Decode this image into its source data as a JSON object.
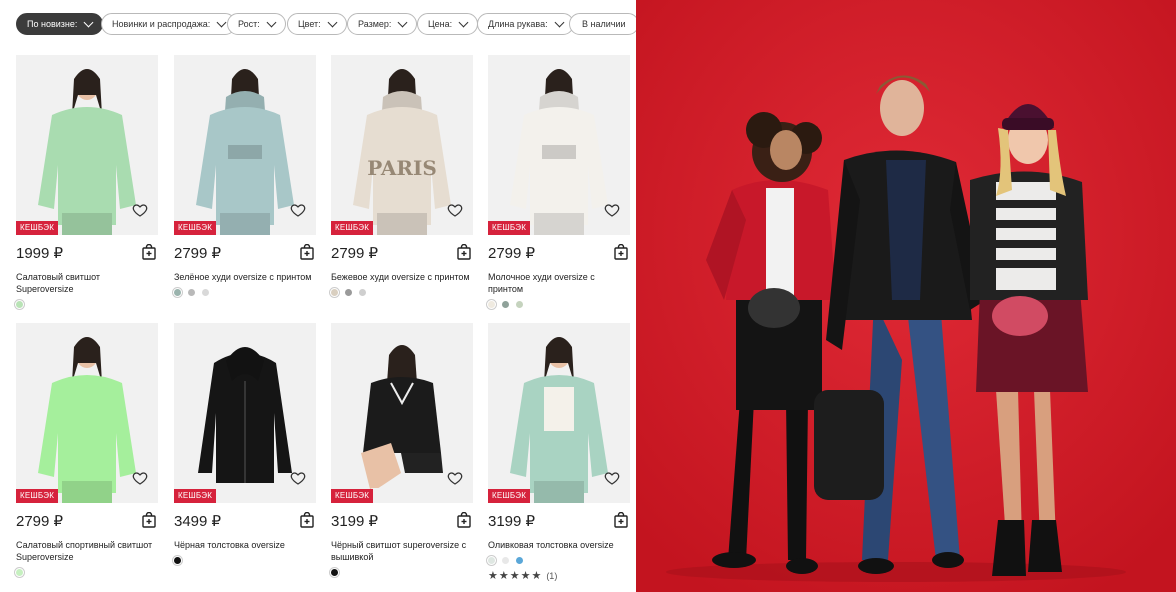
{
  "filters": [
    {
      "label": "По новизне:",
      "active": true,
      "dropdown": true
    },
    {
      "label": "Новинки и распродажа:",
      "active": false,
      "dropdown": true
    },
    {
      "label": "Рост:",
      "active": false,
      "dropdown": true
    },
    {
      "label": "Цвет:",
      "active": false,
      "dropdown": true
    },
    {
      "label": "Размер:",
      "active": false,
      "dropdown": true
    },
    {
      "label": "Цена:",
      "active": false,
      "dropdown": true
    },
    {
      "label": "Длина рукава:",
      "active": false,
      "dropdown": true
    },
    {
      "label": "В наличии",
      "active": false,
      "dropdown": false
    }
  ],
  "products": [
    {
      "badge": "КЕШБЭК",
      "price": "1999 ₽",
      "title": "Салатовый свитшот Superoversize",
      "swatches": [
        "#b9e3b6"
      ],
      "garment_color": "#a9dcb0",
      "garment_type": "sweatshirt"
    },
    {
      "badge": "КЕШБЭК",
      "price": "2799 ₽",
      "title": "Зелёное худи oversize с принтом",
      "swatches": [
        "#9ab3ad",
        "#b9b9b9",
        "#d9d9d9"
      ],
      "garment_color": "#a8c7c8",
      "garment_type": "hoodie"
    },
    {
      "badge": "КЕШБЭК",
      "price": "2799 ₽",
      "title": "Бежевое худи oversize с принтом",
      "swatches": [
        "#d9cfc0",
        "#9a9a9a",
        "#cfcfcf"
      ],
      "garment_color": "#e6ddd1",
      "garment_type": "hoodie-paris",
      "print": "PARIS"
    },
    {
      "badge": "КЕШБЭК",
      "price": "2799 ₽",
      "title": "Молочное худи oversize с принтом",
      "swatches": [
        "#efeae0",
        "#8fa29a",
        "#c5d3be"
      ],
      "garment_color": "#f3f1ec",
      "garment_type": "hoodie"
    },
    {
      "badge": "КЕШБЭК",
      "price": "2799 ₽",
      "title": "Салатовый спортивный свитшот Superoversize",
      "swatches": [
        "#c6f0c0"
      ],
      "garment_color": "#a5ef9c",
      "garment_type": "sweatshirt"
    },
    {
      "badge": "КЕШБЭК",
      "price": "3499 ₽",
      "title": "Чёрная толстовка oversize",
      "swatches": [
        "#111111"
      ],
      "garment_color": "#151515",
      "garment_type": "zip-hoodie"
    },
    {
      "badge": "КЕШБЭК",
      "price": "3199 ₽",
      "title": "Чёрный свитшот superoversize с вышивкой",
      "swatches": [
        "#111111"
      ],
      "garment_color": "#1b1b1b",
      "garment_type": "sweatshirt-seated"
    },
    {
      "badge": "КЕШБЭК",
      "price": "3199 ₽",
      "title": "Оливковая толстовка oversize",
      "swatches": [
        "#dfe7e2",
        "#e8e8e8",
        "#5aa7d8"
      ],
      "garment_color": "#a9d3c2",
      "garment_type": "set",
      "rating": {
        "stars": 5,
        "count": "(1)"
      }
    }
  ],
  "colors": {
    "badge": "#d6223c",
    "active_chip": "#3b3b3b",
    "promo_bg": "#d51f2c"
  },
  "icons": {
    "favorite": "heart-icon",
    "cart": "shopping-bag-icon",
    "dropdown": "chevron-down-icon",
    "rating": "star-icon"
  }
}
